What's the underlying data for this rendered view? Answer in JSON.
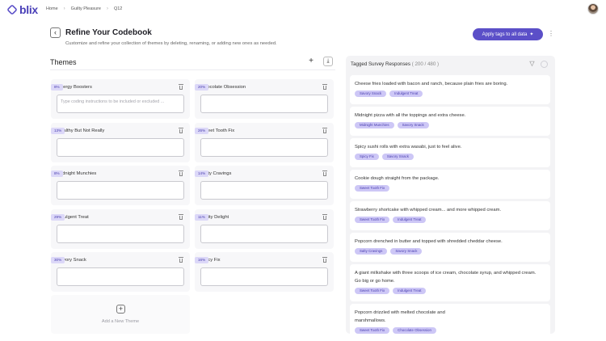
{
  "app": {
    "logo_text": "blix",
    "brand_color": "#5b4fc8"
  },
  "breadcrumb": [
    "Home",
    "Guilty Pleasure",
    "Q12"
  ],
  "header": {
    "title": "Refine Your Codebook",
    "subtitle": "Customize and refine your collection of themes by deleting, renaming, or adding new ones as needed.",
    "apply_label": "Apply tags to all data",
    "apply_icon": "sparkles-icon",
    "more_icon": "more-vertical-icon"
  },
  "themes_panel": {
    "title": "Themes",
    "input_placeholder": "Type coding instructions to be included or excluded ...",
    "add_new_label": "Add a New Theme",
    "themes": [
      {
        "name": "Energy Boosters",
        "pct": "8%"
      },
      {
        "name": "Chocolate Obsession",
        "pct": "20%"
      },
      {
        "name": "Healthy But Not Really",
        "pct": "13%"
      },
      {
        "name": "Sweet Tooth Fix",
        "pct": "26%"
      },
      {
        "name": "Midnight Munchies",
        "pct": "8%"
      },
      {
        "name": "Salty Cravings",
        "pct": "14%"
      },
      {
        "name": "Indulgent Treat",
        "pct": "29%"
      },
      {
        "name": "Fruity Delight",
        "pct": "11%"
      },
      {
        "name": "Savory Snack",
        "pct": "30%"
      },
      {
        "name": "Spicy Fix",
        "pct": "16%"
      }
    ]
  },
  "responses_panel": {
    "title": "Tagged Survey Responses",
    "count": "( 200 / 480 )",
    "responses": [
      {
        "text": "Cheese fries loaded with bacon and ranch, because plain fries are boring.",
        "tags": [
          "Savory Snack",
          "Indulgent Treat"
        ]
      },
      {
        "text": "Midnight pizza with all the toppings and extra cheese.",
        "tags": [
          "Midnight Munchies",
          "Savory Snack"
        ]
      },
      {
        "text": "Spicy sushi rolls with extra wasabi, just to feel alive.",
        "tags": [
          "Spicy Fix",
          "Savory Snack"
        ]
      },
      {
        "text": "Cookie dough straight from the package.",
        "tags": [
          "Sweet Tooth Fix"
        ]
      },
      {
        "text": "Strawberry shortcake with whipped cream... and more whipped cream.",
        "tags": [
          "Sweet Tooth Fix",
          "Indulgent Treat"
        ]
      },
      {
        "text": "Popcorn drenched in butter and topped with shredded cheddar cheese.",
        "tags": [
          "Salty Cravings",
          "Savory Snack"
        ]
      },
      {
        "text": "A giant milkshake with three scoops of ice cream, chocolate syrup, and whipped cream. Go big or go home.",
        "tags": [
          "Sweet Tooth Fix",
          "Indulgent Treat"
        ]
      },
      {
        "text": "Popcorn drizzled with melted chocolate and marshmallows.",
        "tags": [
          "Sweet Tooth Fix",
          "Chocolate Obsession"
        ]
      }
    ]
  }
}
